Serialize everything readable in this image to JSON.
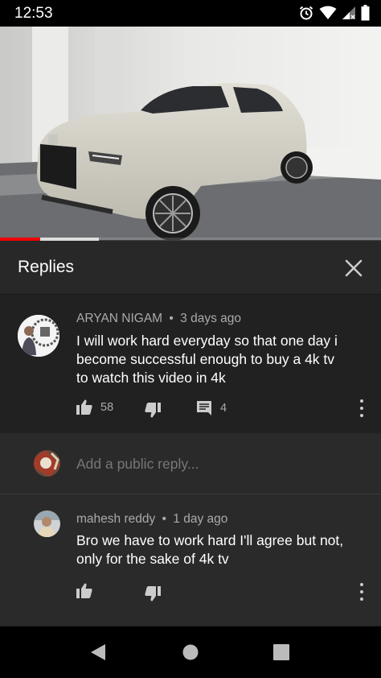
{
  "status_bar": {
    "time": "12:53",
    "icons": [
      "alarm-icon",
      "wifi-icon",
      "signal-icon",
      "battery-icon"
    ]
  },
  "video": {
    "progress_played": 0.105,
    "progress_buffered": 0.26
  },
  "replies_panel": {
    "title": "Replies",
    "close_icon": "close-icon"
  },
  "parent_comment": {
    "author": "ARYAN NIGAM",
    "time": "3 days ago",
    "text_lines": [
      "I will work hard everyday so that one day i",
      "become successful enough to buy a 4k tv",
      "to watch this video in 4k"
    ],
    "likes": "58",
    "replies_count": "4"
  },
  "reply_input": {
    "placeholder": "Add a public reply..."
  },
  "reply": {
    "author": "mahesh reddy",
    "time": "1 day ago",
    "text_lines": [
      "Bro we have to work hard  I'll agree but not,",
      "only for the sake of 4k tv"
    ]
  },
  "separator": "•",
  "colors": {
    "background": "#212121",
    "panel": "#2a2a2a",
    "progress_red": "#ee0000",
    "meta_gray": "#aaaaaa"
  }
}
